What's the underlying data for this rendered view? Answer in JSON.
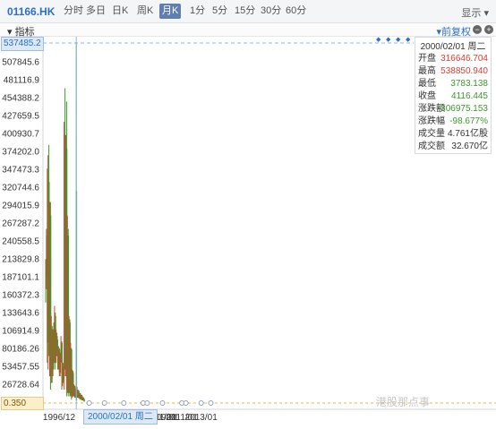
{
  "toolbar": {
    "symbol": "01166.HK",
    "timeframes": [
      "分时",
      "多日",
      "日K",
      "周K",
      "月K",
      "1分",
      "5分",
      "15分",
      "30分",
      "60分"
    ],
    "active_timeframe": "月K",
    "display_label": "显示 ▾"
  },
  "indicator_bar": {
    "label": "▾ 指标",
    "adjust_label": "▾前复权"
  },
  "price_tags": {
    "top": "537485.2",
    "bottom": "0.350"
  },
  "cursor_date": "2000/02/01 周二",
  "info_panel": {
    "date": "2000/02/01 周二",
    "rows": [
      {
        "key": "开盘",
        "value": "316646.704",
        "color": "#e03c31"
      },
      {
        "key": "最高",
        "value": "538850.940",
        "color": "#e03c31"
      },
      {
        "key": "最低",
        "value": "3783.138",
        "color": "#3a9a2a"
      },
      {
        "key": "收盘",
        "value": "4116.445",
        "color": "#3a9a2a"
      },
      {
        "key": "涨跌额",
        "value": "-306975.153",
        "color": "#3a9a2a"
      },
      {
        "key": "涨跌幅",
        "value": "-98.677%",
        "color": "#3a9a2a"
      },
      {
        "key": "成交量",
        "value": "4.761亿股",
        "color": "#333333"
      },
      {
        "key": "成交额",
        "value": "32.670亿",
        "color": "#333333"
      }
    ]
  },
  "watermark": "港股那点事",
  "colors": {
    "up": "#e03c31",
    "down": "#3a9a2a",
    "accent": "#2b6fc8",
    "cursor": "#8fb4e3"
  },
  "chart_data": {
    "type": "candlestick",
    "y_tick_labels": [
      "537485.2",
      "507845.6",
      "481116.9",
      "454388.2",
      "427659.5",
      "400930.7",
      "374202.0",
      "347473.3",
      "320744.6",
      "294015.9",
      "267287.2",
      "240558.5",
      "213829.8",
      "187101.1",
      "160372.3",
      "133643.6",
      "106914.9",
      "80186.26",
      "53457.55",
      "26728.64",
      "0.350"
    ],
    "ylim": [
      0,
      537485.2
    ],
    "x_tick_labels": [
      "1996/12",
      "2001/01",
      "2003/01",
      "2005/01",
      "2007/01",
      "2009/01",
      "2011/01",
      "2013/01"
    ],
    "cursor": "2000/02/01",
    "candles": [
      {
        "t": "1996/12",
        "o": 200000,
        "h": 215000,
        "l": 150000,
        "c": 190000
      },
      {
        "t": "1997/01",
        "o": 190000,
        "h": 260000,
        "l": 170000,
        "c": 250000
      },
      {
        "t": "1997/02",
        "o": 250000,
        "h": 350000,
        "l": 60000,
        "c": 90000
      },
      {
        "t": "1997/03",
        "o": 120000,
        "h": 370000,
        "l": 50000,
        "c": 330000
      },
      {
        "t": "1997/04",
        "o": 330000,
        "h": 385000,
        "l": 70000,
        "c": 90000
      },
      {
        "t": "1997/05",
        "o": 100000,
        "h": 300000,
        "l": 40000,
        "c": 280000
      },
      {
        "t": "1997/06",
        "o": 280000,
        "h": 300000,
        "l": 20000,
        "c": 40000
      },
      {
        "t": "1997/07",
        "o": 60000,
        "h": 130000,
        "l": 30000,
        "c": 110000
      },
      {
        "t": "1997/08",
        "o": 110000,
        "h": 115000,
        "l": 30000,
        "c": 40000
      },
      {
        "t": "1997/09",
        "o": 50000,
        "h": 110000,
        "l": 40000,
        "c": 100000
      },
      {
        "t": "1997/10",
        "o": 100000,
        "h": 120000,
        "l": 50000,
        "c": 60000
      },
      {
        "t": "1997/11",
        "o": 70000,
        "h": 145000,
        "l": 60000,
        "c": 130000
      },
      {
        "t": "1997/12",
        "o": 130000,
        "h": 135000,
        "l": 50000,
        "c": 60000
      },
      {
        "t": "1998/01",
        "o": 70000,
        "h": 110000,
        "l": 60000,
        "c": 100000
      },
      {
        "t": "1998/02",
        "o": 100000,
        "h": 105000,
        "l": 70000,
        "c": 80000
      },
      {
        "t": "1998/03",
        "o": 80000,
        "h": 95000,
        "l": 50000,
        "c": 60000
      },
      {
        "t": "1998/04",
        "o": 60000,
        "h": 85000,
        "l": 50000,
        "c": 80000
      },
      {
        "t": "1998/05",
        "o": 80000,
        "h": 82000,
        "l": 40000,
        "c": 45000
      },
      {
        "t": "1998/06",
        "o": 45000,
        "h": 75000,
        "l": 40000,
        "c": 70000
      },
      {
        "t": "1998/07",
        "o": 70000,
        "h": 100000,
        "l": 60000,
        "c": 90000
      },
      {
        "t": "1998/08",
        "o": 90000,
        "h": 92000,
        "l": 20000,
        "c": 30000
      },
      {
        "t": "1998/09",
        "o": 30000,
        "h": 60000,
        "l": 25000,
        "c": 55000
      },
      {
        "t": "1998/10",
        "o": 55000,
        "h": 60000,
        "l": 30000,
        "c": 35000
      },
      {
        "t": "1998/11",
        "o": 40000,
        "h": 420000,
        "l": 20000,
        "c": 400000
      },
      {
        "t": "1998/12",
        "o": 400000,
        "h": 470000,
        "l": 50000,
        "c": 60000
      },
      {
        "t": "1999/01",
        "o": 60000,
        "h": 400000,
        "l": 40000,
        "c": 380000
      },
      {
        "t": "1999/02",
        "o": 380000,
        "h": 450000,
        "l": 10000,
        "c": 20000
      },
      {
        "t": "1999/03",
        "o": 20000,
        "h": 280000,
        "l": 15000,
        "c": 250000
      },
      {
        "t": "1999/04",
        "o": 250000,
        "h": 260000,
        "l": 10000,
        "c": 15000
      },
      {
        "t": "1999/05",
        "o": 20000,
        "h": 130000,
        "l": 15000,
        "c": 120000
      },
      {
        "t": "1999/06",
        "o": 120000,
        "h": 125000,
        "l": 10000,
        "c": 15000
      },
      {
        "t": "1999/07",
        "o": 15000,
        "h": 90000,
        "l": 10000,
        "c": 80000
      },
      {
        "t": "1999/08",
        "o": 80000,
        "h": 82000,
        "l": 5000,
        "c": 10000
      },
      {
        "t": "1999/09",
        "o": 10000,
        "h": 50000,
        "l": 8000,
        "c": 45000
      },
      {
        "t": "1999/10",
        "o": 45000,
        "h": 48000,
        "l": 10000,
        "c": 15000
      },
      {
        "t": "1999/11",
        "o": 15000,
        "h": 28000,
        "l": 10000,
        "c": 25000
      },
      {
        "t": "1999/12",
        "o": 25000,
        "h": 26000,
        "l": 8000,
        "c": 10000
      },
      {
        "t": "2000/01",
        "o": 10000,
        "h": 22000,
        "l": 8000,
        "c": 20000
      },
      {
        "t": "2000/02",
        "o": 316646.704,
        "h": 538850.94,
        "l": 3783.138,
        "c": 4116.445
      },
      {
        "t": "2000/03",
        "o": 20000,
        "h": 24000,
        "l": 8000,
        "c": 10000
      },
      {
        "t": "2000/04",
        "o": 10000,
        "h": 20000,
        "l": 8000,
        "c": 18000
      },
      {
        "t": "2000/05",
        "o": 18000,
        "h": 19000,
        "l": 7000,
        "c": 8000
      },
      {
        "t": "2000/06",
        "o": 8000,
        "h": 15000,
        "l": 6000,
        "c": 14000
      },
      {
        "t": "2000/07",
        "o": 14000,
        "h": 15000,
        "l": 5000,
        "c": 6000
      },
      {
        "t": "2000/08",
        "o": 6000,
        "h": 12000,
        "l": 5000,
        "c": 11000
      },
      {
        "t": "2000/09",
        "o": 11000,
        "h": 12000,
        "l": 4000,
        "c": 5000
      },
      {
        "t": "2000/10",
        "o": 5000,
        "h": 9000,
        "l": 4000,
        "c": 8000
      },
      {
        "t": "2000/11",
        "o": 8000,
        "h": 8500,
        "l": 3000,
        "c": 3500
      },
      {
        "t": "2000/12",
        "o": 3500,
        "h": 6000,
        "l": 2000,
        "c": 2500
      }
    ],
    "tail_points": [
      "2001/06",
      "2003/01",
      "2005/01",
      "2007/01",
      "2007/06",
      "2009/01",
      "2011/01",
      "2011/06",
      "2013/01",
      "2014/01"
    ]
  }
}
